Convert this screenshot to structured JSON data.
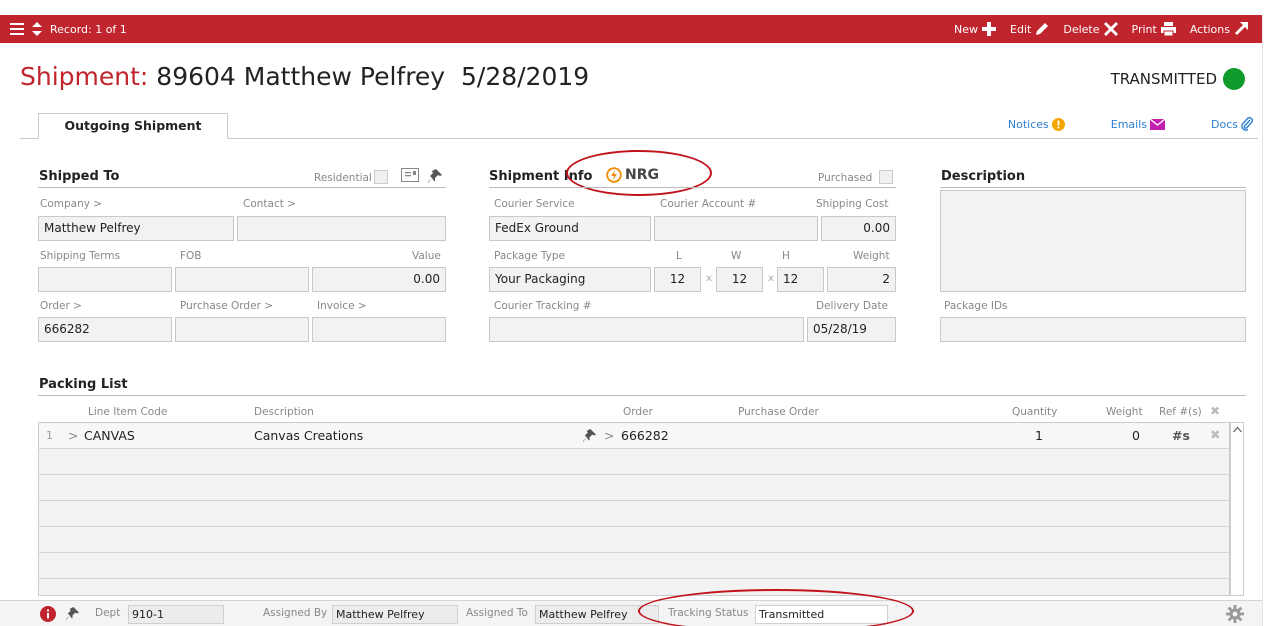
{
  "topbar": {
    "record_label": "Record: 1 of 1",
    "actions": [
      {
        "label": "New",
        "icon": "plus-icon"
      },
      {
        "label": "Edit",
        "icon": "pencil-icon"
      },
      {
        "label": "Delete",
        "icon": "x-icon"
      },
      {
        "label": "Print",
        "icon": "printer-icon"
      },
      {
        "label": "Actions",
        "icon": "arrow-icon"
      }
    ],
    "color": "#c0252d"
  },
  "header": {
    "title_label": "Shipment:",
    "title_value": "89604 Matthew Pelfrey  5/28/2019",
    "status_text": "TRANSMITTED",
    "status_color": "#0f9a2c"
  },
  "tabs": [
    {
      "label": "Outgoing Shipment"
    }
  ],
  "links": {
    "notices": "Notices",
    "emails": "Emails",
    "docs": "Docs"
  },
  "shipped_to": {
    "heading": "Shipped To",
    "residential_label": "Residential",
    "company_label": "Company >",
    "company_value": "Matthew Pelfrey",
    "contact_label": "Contact >",
    "contact_value": "",
    "shipping_terms_label": "Shipping Terms",
    "fob_label": "FOB",
    "value_label": "Value",
    "value_value": "0.00",
    "order_label": "Order >",
    "order_value": "666282",
    "po_label": "Purchase Order >",
    "invoice_label": "Invoice >"
  },
  "shipment_info": {
    "heading": "Shipment Info",
    "logo_text": "NRG",
    "purchased_label": "Purchased",
    "courier_service_label": "Courier Service",
    "courier_service_value": "FedEx Ground",
    "courier_account_label": "Courier Account #",
    "shipping_cost_label": "Shipping Cost",
    "shipping_cost_value": "0.00",
    "package_type_label": "Package Type",
    "package_type_value": "Your Packaging",
    "l_label": "L",
    "w_label": "W",
    "h_label": "H",
    "weight_label": "Weight",
    "l_value": "12",
    "w_value": "12",
    "h_value": "12",
    "weight_value": "2",
    "x_sep": "x",
    "tracking_label": "Courier Tracking #",
    "delivery_label": "Delivery Date",
    "delivery_value": "05/28/19"
  },
  "description": {
    "heading": "Description",
    "package_ids_label": "Package IDs"
  },
  "packing_list": {
    "heading": "Packing List",
    "columns": [
      "Line Item Code",
      "Description",
      "Order",
      "Purchase Order",
      "Quantity",
      "Weight",
      "Ref #(s)"
    ],
    "rows": [
      {
        "num": "1",
        "arrow": ">",
        "code": "CANVAS",
        "description": "Canvas Creations",
        "order_arrow": ">",
        "order": "666282",
        "quantity": "1",
        "weight": "0",
        "ref_icon": "#s"
      }
    ]
  },
  "bottombar": {
    "dept_label": "Dept",
    "dept_value": "910-1",
    "assigned_by_label": "Assigned By",
    "assigned_by_value": "Matthew Pelfrey",
    "assigned_to_label": "Assigned To",
    "assigned_to_value": "Matthew Pelfrey",
    "tracking_status_label": "Tracking Status",
    "tracking_status_value": "Transmitted"
  }
}
